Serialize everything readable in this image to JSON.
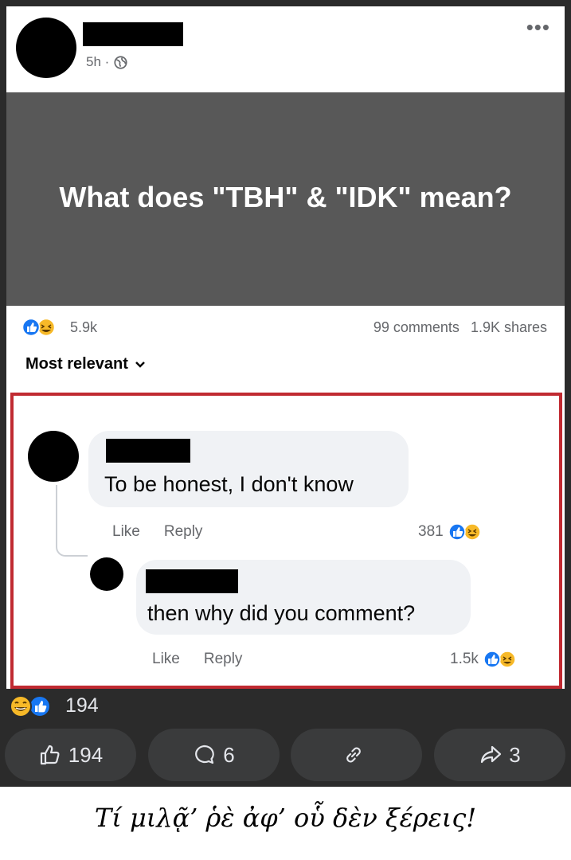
{
  "post": {
    "time": "5h ·",
    "more_label": "•••",
    "image_text": "What does \"TBH\" & \"IDK\" mean?",
    "reaction_count": "5.9k",
    "comments_count": "99 comments",
    "shares_count": "1.9K shares",
    "sort_label": "Most relevant"
  },
  "comments": [
    {
      "text": "To be honest, I don't know",
      "like_label": "Like",
      "reply_label": "Reply",
      "reaction_count": "381"
    },
    {
      "text": "then why did you comment?",
      "like_label": "Like",
      "reply_label": "Reply",
      "reaction_count": "1.5k"
    }
  ],
  "footer": {
    "reaction_count": "194",
    "actions": [
      {
        "icon": "thumbs-up-icon",
        "label": "194"
      },
      {
        "icon": "comment-icon",
        "label": "6"
      },
      {
        "icon": "link-icon",
        "label": ""
      },
      {
        "icon": "share-arrow-icon",
        "label": "3"
      }
    ]
  },
  "caption": "Τί μιλᾷ’ ῥὲ ἀφ’ οὗ δὲν ξέρεις!",
  "colors": {
    "like_blue": "#1877f2",
    "haha_yellow": "#f7b928",
    "highlight_border": "#c02a31",
    "banner_gray": "#585858",
    "dark_bg": "#2b2b2b",
    "pill_bg": "#3a3b3c"
  }
}
